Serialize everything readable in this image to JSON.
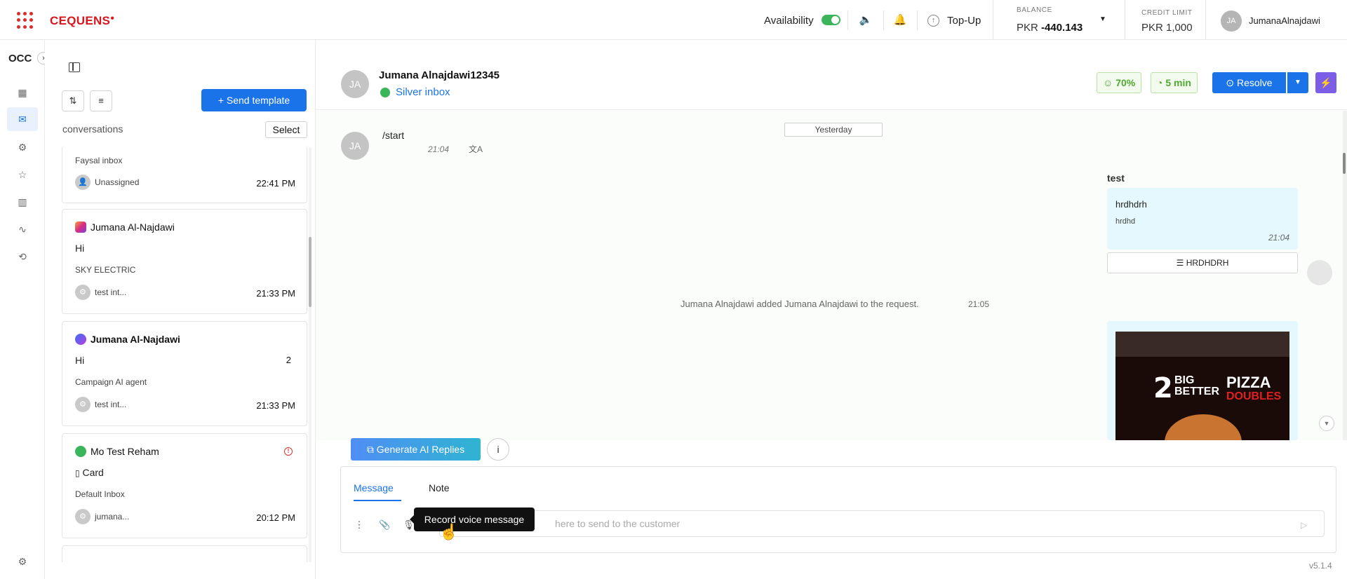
{
  "topbar": {
    "logo": "CEQUENS",
    "availability_label": "Availability",
    "topup_label": "Top-Up",
    "balance_label": "BALANCE",
    "balance_currency": "PKR",
    "balance_value": "-440.143",
    "credit_label": "CREDIT LIMIT",
    "credit_value": "PKR 1,000",
    "user_initials": "JA",
    "user_name": "JumanaAlnajdawi",
    "accent_color": "#1a73e8",
    "brand_color": "#d9151e"
  },
  "nav": {
    "workspace": "OCC",
    "items": [
      "dashboard-icon",
      "inbox-icon",
      "bot-icon",
      "star-icon",
      "chart-icon",
      "activity-icon",
      "history-icon",
      "settings-icon"
    ]
  },
  "conversations": {
    "send_template_label": "+ Send template",
    "section_label": "conversations",
    "select_label": "Select",
    "items": [
      {
        "title": "",
        "channel": "",
        "message": "",
        "inbox": "Faysal inbox",
        "assignee": "Unassigned",
        "time": "22:41 PM",
        "badge": ""
      },
      {
        "title": "Jumana Al-Najdawi",
        "channel": "instagram",
        "message": "Hi",
        "inbox": "SKY ELECTRIC",
        "assignee": "test int...",
        "time": "21:33 PM",
        "badge": ""
      },
      {
        "title": "Jumana Al-Najdawi",
        "channel": "messenger",
        "message": "Hi",
        "inbox": "Campaign AI agent",
        "assignee": "test int...",
        "time": "21:33 PM",
        "badge": "2"
      },
      {
        "title": "Mo Test Reham",
        "channel": "whatsapp",
        "message": "Card",
        "inbox": "Default Inbox",
        "assignee": "jumana...",
        "time": "20:12 PM",
        "badge": ""
      }
    ]
  },
  "chat": {
    "contact_initials": "JA",
    "contact_name": "Jumana Alnajdawi12345",
    "inbox_name": "Silver inbox",
    "score": "70%",
    "wait": "5 min",
    "resolve_label": "Resolve",
    "date_chip": "Yesterday",
    "incoming": {
      "text": "/start",
      "time": "21:04"
    },
    "outgoing": {
      "title": "test",
      "header": "hrdhdrh",
      "body": "hrdhd",
      "time": "21:04",
      "button": "HRDHDRH"
    },
    "system": {
      "text": "Jumana Alnajdawi added Jumana Alnajdawi to the request.",
      "time": "21:05"
    },
    "image": {
      "line1": "2",
      "line2a": "BIG",
      "line2b": "BETTER",
      "line3": "PIZZA",
      "line4": "DOUBLES"
    }
  },
  "composer": {
    "gen_ai_label": "Generate AI Replies",
    "info_label": "i",
    "tab_message": "Message",
    "tab_note": "Note",
    "placeholder_visible": "here to send to the customer",
    "tooltip": "Record voice message"
  },
  "version": "v5.1.4"
}
